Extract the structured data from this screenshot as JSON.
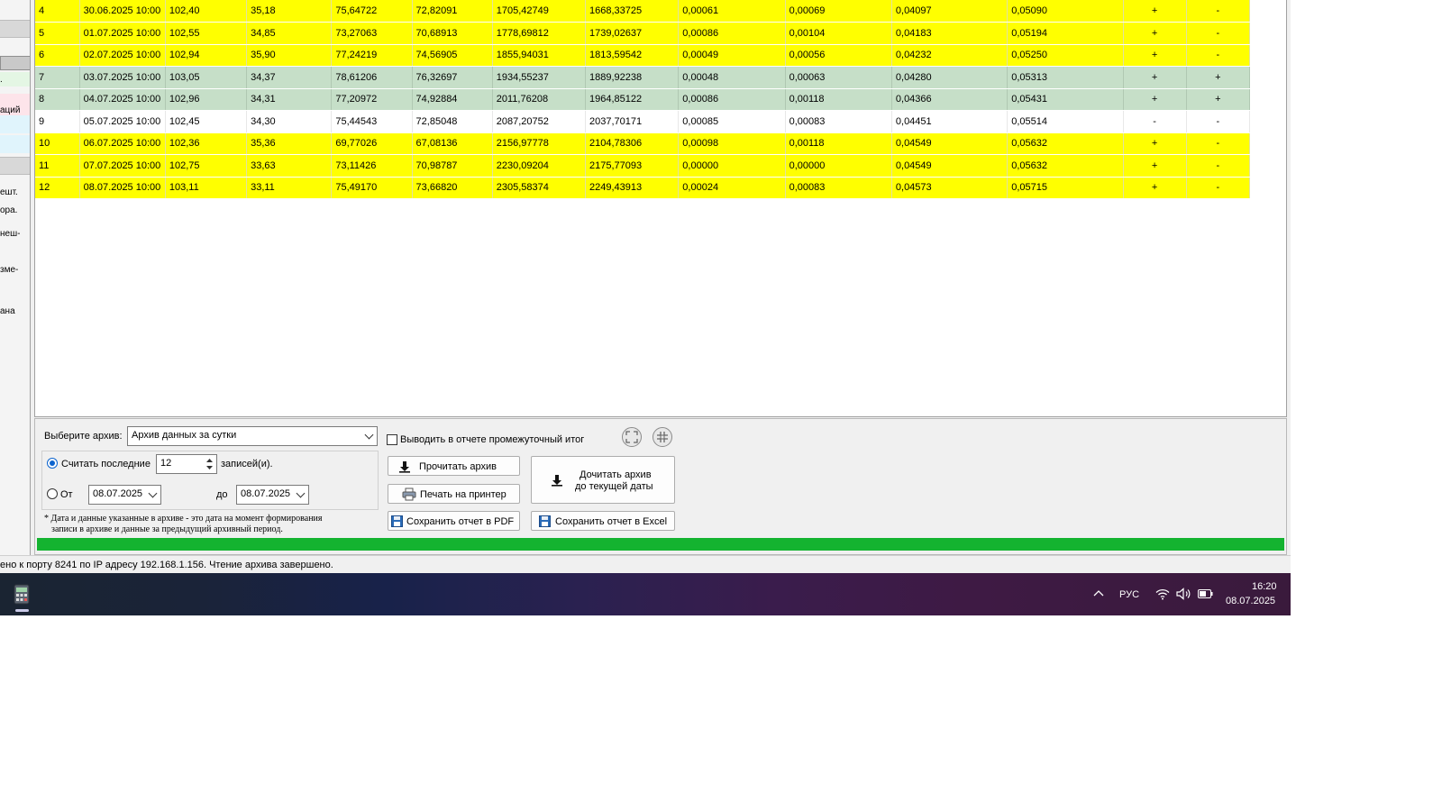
{
  "sidebar": {
    "fragments": [
      "ешт.",
      "ора.",
      "неш-",
      "зме-",
      "ана",
      "аций",
      "."
    ]
  },
  "table": {
    "rows": [
      {
        "style": "yellow",
        "cells": [
          "4",
          "30.06.2025 10:00",
          "102,40",
          "35,18",
          "75,64722",
          "72,82091",
          "1705,42749",
          "1668,33725",
          "0,00061",
          "0,00069",
          "0,04097",
          "0,05090",
          "+",
          "-"
        ]
      },
      {
        "style": "yellow",
        "cells": [
          "5",
          "01.07.2025 10:00",
          "102,55",
          "34,85",
          "73,27063",
          "70,68913",
          "1778,69812",
          "1739,02637",
          "0,00086",
          "0,00104",
          "0,04183",
          "0,05194",
          "+",
          "-"
        ]
      },
      {
        "style": "yellow",
        "cells": [
          "6",
          "02.07.2025 10:00",
          "102,94",
          "35,90",
          "77,24219",
          "74,56905",
          "1855,94031",
          "1813,59542",
          "0,00049",
          "0,00056",
          "0,04232",
          "0,05250",
          "+",
          "-"
        ]
      },
      {
        "style": "green",
        "cells": [
          "7",
          "03.07.2025 10:00",
          "103,05",
          "34,37",
          "78,61206",
          "76,32697",
          "1934,55237",
          "1889,92238",
          "0,00048",
          "0,00063",
          "0,04280",
          "0,05313",
          "+",
          "+"
        ]
      },
      {
        "style": "green",
        "cells": [
          "8",
          "04.07.2025 10:00",
          "102,96",
          "34,31",
          "77,20972",
          "74,92884",
          "2011,76208",
          "1964,85122",
          "0,00086",
          "0,00118",
          "0,04366",
          "0,05431",
          "+",
          "+"
        ]
      },
      {
        "style": "white",
        "cells": [
          "9",
          "05.07.2025 10:00",
          "102,45",
          "34,30",
          "75,44543",
          "72,85048",
          "2087,20752",
          "2037,70171",
          "0,00085",
          "0,00083",
          "0,04451",
          "0,05514",
          "-",
          "-"
        ]
      },
      {
        "style": "yellow",
        "cells": [
          "10",
          "06.07.2025 10:00",
          "102,36",
          "35,36",
          "69,77026",
          "67,08136",
          "2156,97778",
          "2104,78306",
          "0,00098",
          "0,00118",
          "0,04549",
          "0,05632",
          "+",
          "-"
        ]
      },
      {
        "style": "yellow",
        "cells": [
          "11",
          "07.07.2025 10:00",
          "102,75",
          "33,63",
          "73,11426",
          "70,98787",
          "2230,09204",
          "2175,77093",
          "0,00000",
          "0,00000",
          "0,04549",
          "0,05632",
          "+",
          "-"
        ]
      },
      {
        "style": "yellow",
        "cells": [
          "12",
          "08.07.2025 10:00",
          "103,11",
          "33,11",
          "75,49170",
          "73,66820",
          "2305,58374",
          "2249,43913",
          "0,00024",
          "0,00083",
          "0,04573",
          "0,05715",
          "+",
          "-"
        ]
      }
    ]
  },
  "panel": {
    "archive_label": "Выберите архив:",
    "archive_value": "Архив данных за сутки",
    "intermediate_label": "Выводить в отчете промежуточный итог",
    "read_last_label": "Считать последние",
    "read_last_count": "12",
    "records_label": "записей(и).",
    "from_label": "От",
    "from_date": "08.07.2025",
    "to_label": "до",
    "to_date": "08.07.2025",
    "note_line1": "* Дата и данные указанные в архиве - это дата на момент формирования",
    "note_line2": "записи в архиве и данные за предыдущий архивный период.",
    "read_archive_button": "Прочитать архив",
    "print_button": "Печать на принтер",
    "save_pdf_button": "Сохранить отчет в PDF",
    "read_to_date_line1": "Дочитать архив",
    "read_to_date_line2": "до текущей даты",
    "save_excel_button": "Сохранить отчет в  Excel",
    "progress": 1.0,
    "progress_color": "#14b330"
  },
  "status": {
    "text": "ено к порту 8241 по IP адресу 192.168.1.156. Чтение архива завершено."
  },
  "taskbar": {
    "language": "РУС",
    "time": "16:20",
    "date": "08.07.2025"
  },
  "colors": {
    "row_yellow": "#ffff00",
    "row_green": "#c6dfc8",
    "row_white": "#ffffff"
  }
}
